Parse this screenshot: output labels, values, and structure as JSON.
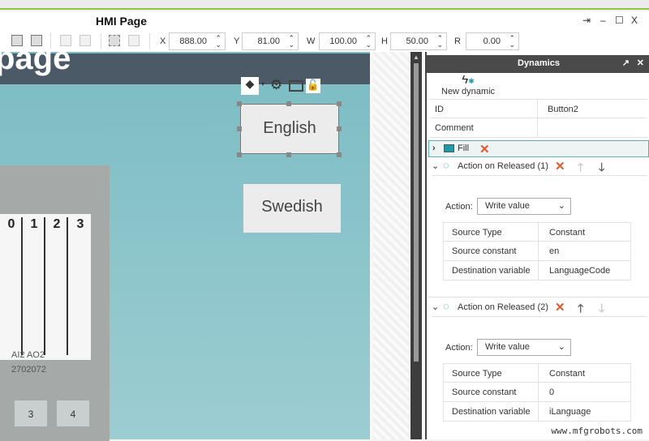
{
  "window": {
    "title": "HMI Page",
    "pin": "⇥",
    "minimize": "–",
    "maximize": "☐",
    "close": "X"
  },
  "toolbar": {
    "x_label": "X",
    "x": "888.00",
    "y_label": "Y",
    "y": "81.00",
    "w_label": "W",
    "w": "100.00",
    "h_label": "H",
    "h": "50.00",
    "r_label": "R",
    "r": "0.00"
  },
  "canvas": {
    "page_title": "page",
    "device": {
      "channels": [
        "0",
        "1",
        "2",
        "3"
      ],
      "line1": "AI2  AO2",
      "line2": "2702072",
      "terminals": [
        "3",
        "4"
      ]
    },
    "buttons": [
      {
        "label": "English"
      },
      {
        "label": "Swedish"
      }
    ]
  },
  "panel": {
    "title": "Dynamics",
    "new_dynamic": "New dynamic",
    "props": [
      {
        "key": "ID",
        "value": "Button2"
      },
      {
        "key": "Comment",
        "value": ""
      }
    ],
    "fill": "Fill",
    "actions": [
      {
        "title": "Action on Released (1)",
        "action_label": "Action:",
        "action": "Write value",
        "rows": [
          {
            "k": "Source Type",
            "v": "Constant"
          },
          {
            "k": "Source constant",
            "v": "en"
          },
          {
            "k": "Destination variable",
            "v": "LanguageCode"
          }
        ]
      },
      {
        "title": "Action on Released (2)",
        "action_label": "Action:",
        "action": "Write value",
        "rows": [
          {
            "k": "Source Type",
            "v": "Constant"
          },
          {
            "k": "Source constant",
            "v": "0"
          },
          {
            "k": "Destination variable",
            "v": "iLanguage"
          }
        ]
      }
    ]
  },
  "watermark": "www.mfgrobots.com",
  "colors": {
    "accent": "#8dc63f",
    "canvas": "#7bbcc3",
    "delete": "#e05a2b",
    "teal": "#1e9ba6"
  }
}
